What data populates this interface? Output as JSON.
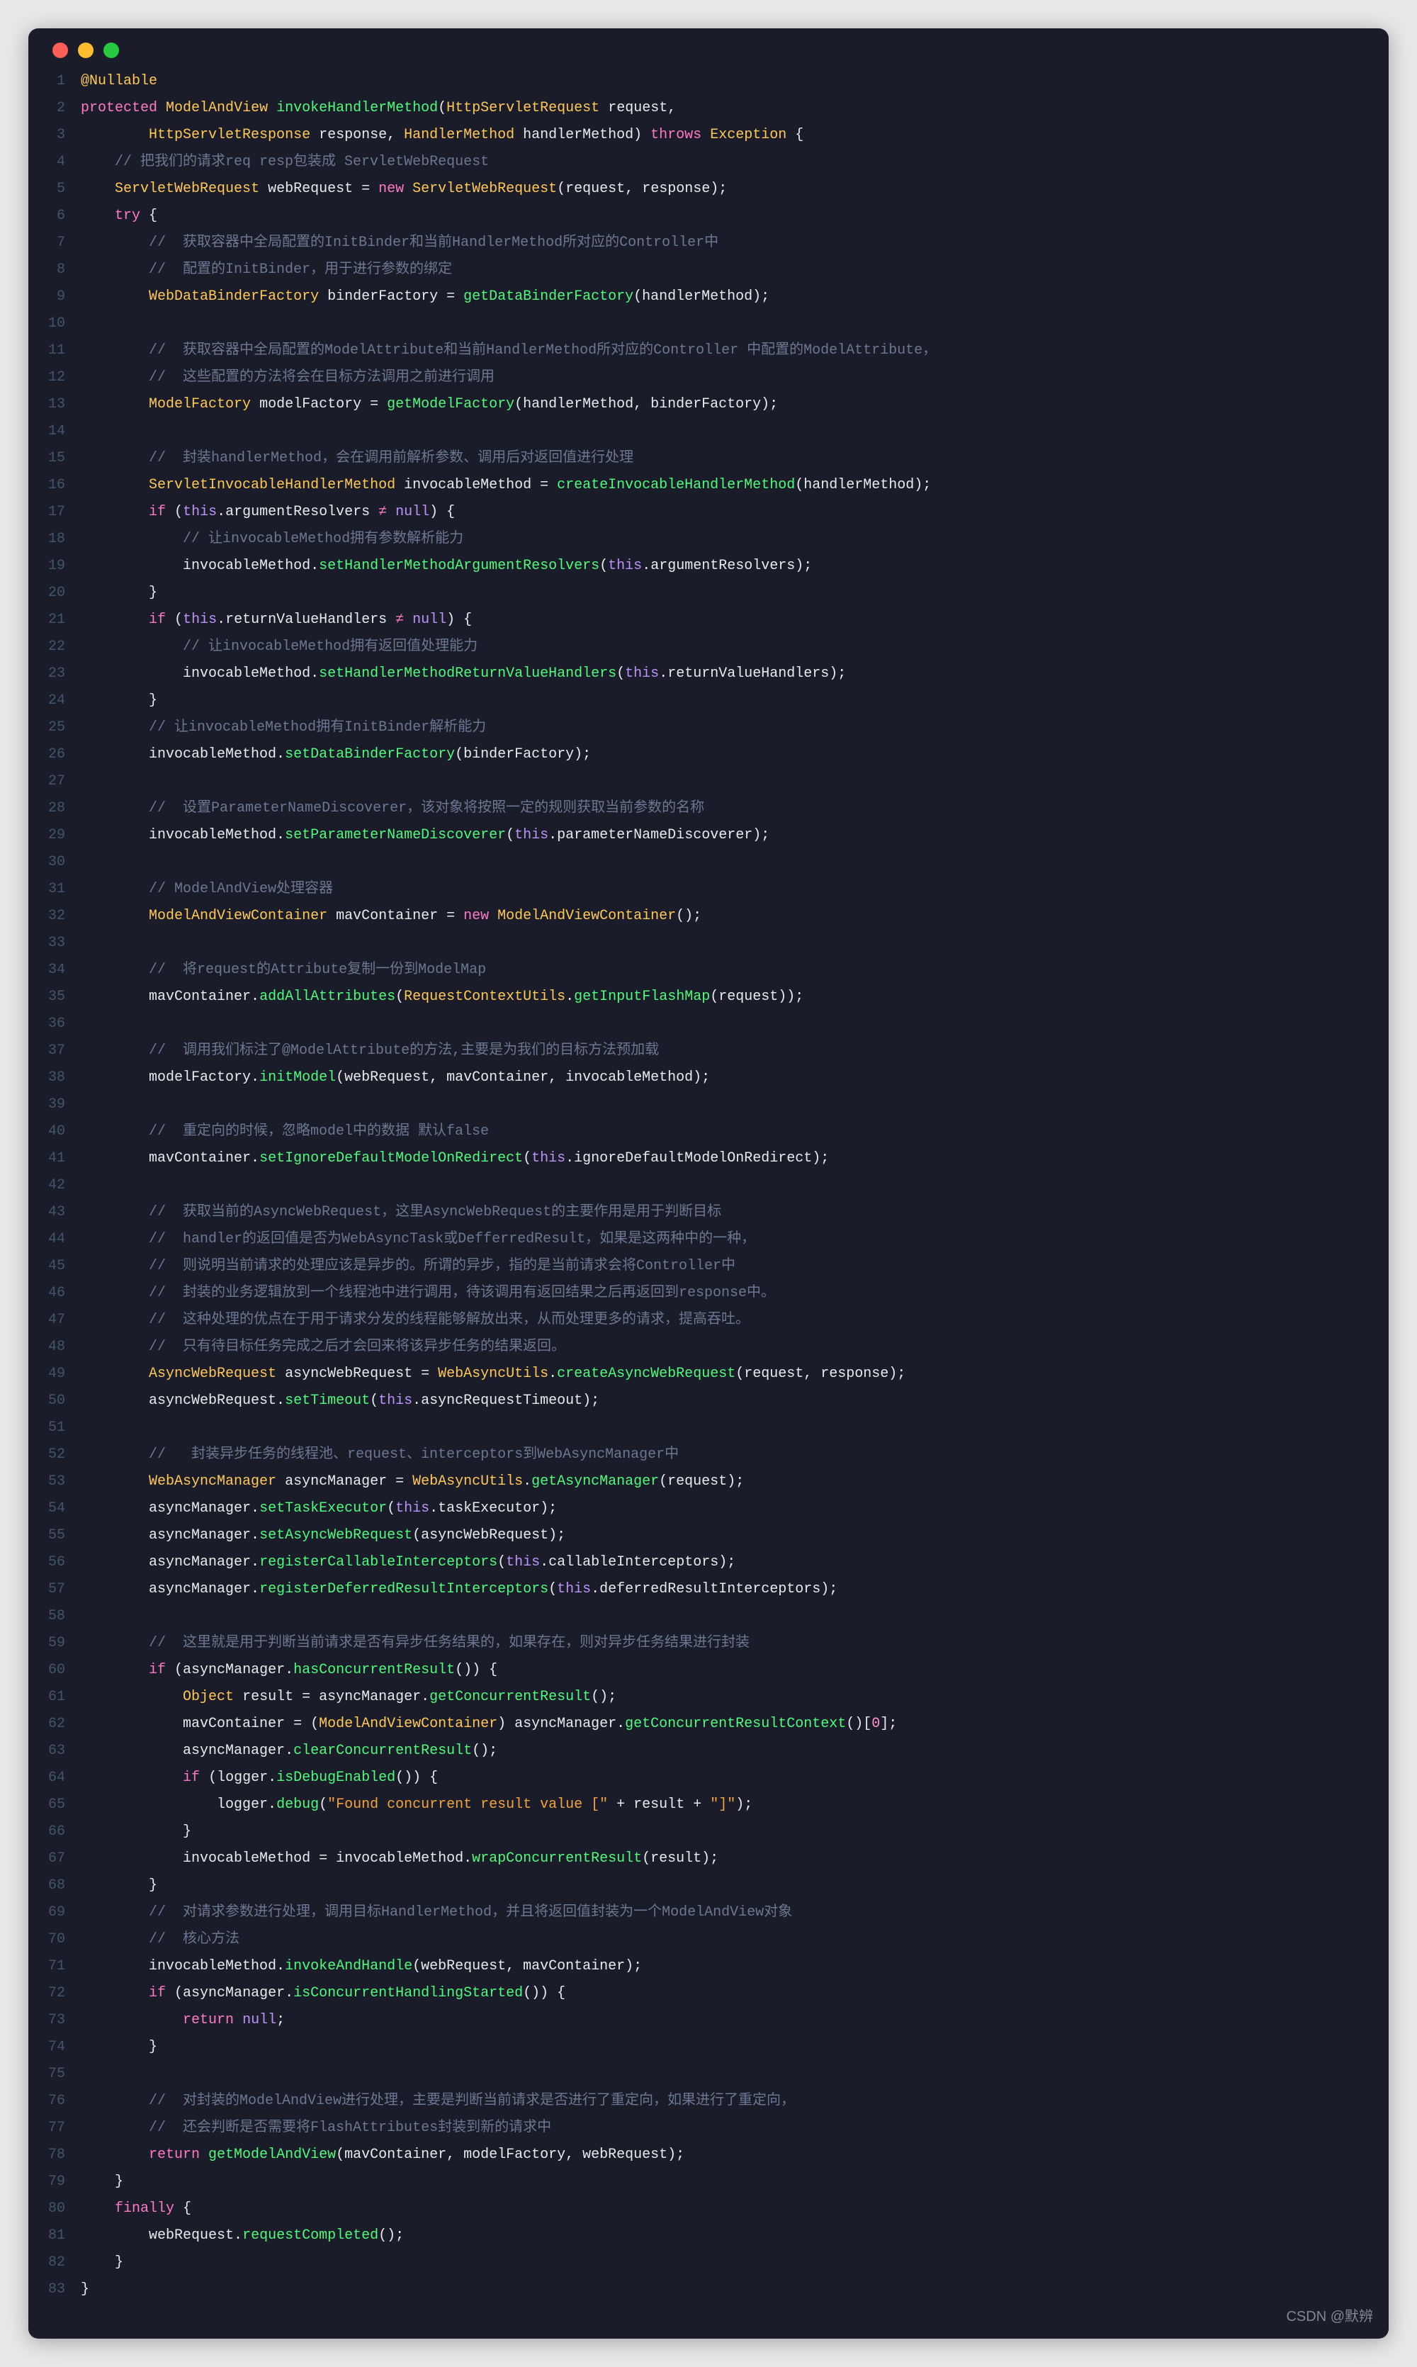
{
  "watermark": "CSDN @默辨",
  "lines": [
    [
      {
        "cls": "ann",
        "txt": "@Nullable"
      }
    ],
    [
      {
        "cls": "key",
        "txt": "protected "
      },
      {
        "cls": "type",
        "txt": "ModelAndView "
      },
      {
        "cls": "fn",
        "txt": "invokeHandlerMethod"
      },
      {
        "cls": "def",
        "txt": "("
      },
      {
        "cls": "type",
        "txt": "HttpServletRequest "
      },
      {
        "cls": "def",
        "txt": "request,"
      }
    ],
    [
      {
        "cls": "def",
        "txt": "        "
      },
      {
        "cls": "type",
        "txt": "HttpServletResponse "
      },
      {
        "cls": "def",
        "txt": "response, "
      },
      {
        "cls": "type",
        "txt": "HandlerMethod "
      },
      {
        "cls": "def",
        "txt": "handlerMethod) "
      },
      {
        "cls": "key",
        "txt": "throws "
      },
      {
        "cls": "type",
        "txt": "Exception "
      },
      {
        "cls": "def",
        "txt": "{"
      }
    ],
    [
      {
        "cls": "def",
        "txt": "    "
      },
      {
        "cls": "comment",
        "txt": "// 把我们的请求req resp包装成 ServletWebRequest"
      }
    ],
    [
      {
        "cls": "def",
        "txt": "    "
      },
      {
        "cls": "type",
        "txt": "ServletWebRequest "
      },
      {
        "cls": "def",
        "txt": "webRequest = "
      },
      {
        "cls": "key",
        "txt": "new "
      },
      {
        "cls": "type",
        "txt": "ServletWebRequest"
      },
      {
        "cls": "def",
        "txt": "(request, response);"
      }
    ],
    [
      {
        "cls": "def",
        "txt": "    "
      },
      {
        "cls": "key",
        "txt": "try "
      },
      {
        "cls": "def",
        "txt": "{"
      }
    ],
    [
      {
        "cls": "def",
        "txt": "        "
      },
      {
        "cls": "comment",
        "txt": "//  获取容器中全局配置的InitBinder和当前HandlerMethod所对应的Controller中"
      }
    ],
    [
      {
        "cls": "def",
        "txt": "        "
      },
      {
        "cls": "comment",
        "txt": "//  配置的InitBinder，用于进行参数的绑定"
      }
    ],
    [
      {
        "cls": "def",
        "txt": "        "
      },
      {
        "cls": "type",
        "txt": "WebDataBinderFactory "
      },
      {
        "cls": "def",
        "txt": "binderFactory = "
      },
      {
        "cls": "fn",
        "txt": "getDataBinderFactory"
      },
      {
        "cls": "def",
        "txt": "(handlerMethod);"
      }
    ],
    [
      {
        "cls": "def",
        "txt": ""
      }
    ],
    [
      {
        "cls": "def",
        "txt": "        "
      },
      {
        "cls": "comment",
        "txt": "//  获取容器中全局配置的ModelAttribute和当前HandlerMethod所对应的Controller 中配置的ModelAttribute，"
      }
    ],
    [
      {
        "cls": "def",
        "txt": "        "
      },
      {
        "cls": "comment",
        "txt": "//  这些配置的方法将会在目标方法调用之前进行调用"
      }
    ],
    [
      {
        "cls": "def",
        "txt": "        "
      },
      {
        "cls": "type",
        "txt": "ModelFactory "
      },
      {
        "cls": "def",
        "txt": "modelFactory = "
      },
      {
        "cls": "fn",
        "txt": "getModelFactory"
      },
      {
        "cls": "def",
        "txt": "(handlerMethod, binderFactory);"
      }
    ],
    [
      {
        "cls": "def",
        "txt": ""
      }
    ],
    [
      {
        "cls": "def",
        "txt": "        "
      },
      {
        "cls": "comment",
        "txt": "//  封装handlerMethod，会在调用前解析参数、调用后对返回值进行处理"
      }
    ],
    [
      {
        "cls": "def",
        "txt": "        "
      },
      {
        "cls": "type",
        "txt": "ServletInvocableHandlerMethod "
      },
      {
        "cls": "def",
        "txt": "invocableMethod = "
      },
      {
        "cls": "fn",
        "txt": "createInvocableHandlerMethod"
      },
      {
        "cls": "def",
        "txt": "(handlerMethod);"
      }
    ],
    [
      {
        "cls": "def",
        "txt": "        "
      },
      {
        "cls": "key",
        "txt": "if "
      },
      {
        "cls": "def",
        "txt": "("
      },
      {
        "cls": "this",
        "txt": "this"
      },
      {
        "cls": "def",
        "txt": ".argumentResolvers "
      },
      {
        "cls": "ne",
        "txt": "≠"
      },
      {
        "cls": "def",
        "txt": " "
      },
      {
        "cls": "null",
        "txt": "null"
      },
      {
        "cls": "def",
        "txt": ") {"
      }
    ],
    [
      {
        "cls": "def",
        "txt": "            "
      },
      {
        "cls": "comment",
        "txt": "// 让invocableMethod拥有参数解析能力"
      }
    ],
    [
      {
        "cls": "def",
        "txt": "            invocableMethod."
      },
      {
        "cls": "fn",
        "txt": "setHandlerMethodArgumentResolvers"
      },
      {
        "cls": "def",
        "txt": "("
      },
      {
        "cls": "this",
        "txt": "this"
      },
      {
        "cls": "def",
        "txt": ".argumentResolvers);"
      }
    ],
    [
      {
        "cls": "def",
        "txt": "        }"
      }
    ],
    [
      {
        "cls": "def",
        "txt": "        "
      },
      {
        "cls": "key",
        "txt": "if "
      },
      {
        "cls": "def",
        "txt": "("
      },
      {
        "cls": "this",
        "txt": "this"
      },
      {
        "cls": "def",
        "txt": ".returnValueHandlers "
      },
      {
        "cls": "ne",
        "txt": "≠"
      },
      {
        "cls": "def",
        "txt": " "
      },
      {
        "cls": "null",
        "txt": "null"
      },
      {
        "cls": "def",
        "txt": ") {"
      }
    ],
    [
      {
        "cls": "def",
        "txt": "            "
      },
      {
        "cls": "comment",
        "txt": "// 让invocableMethod拥有返回值处理能力"
      }
    ],
    [
      {
        "cls": "def",
        "txt": "            invocableMethod."
      },
      {
        "cls": "fn",
        "txt": "setHandlerMethodReturnValueHandlers"
      },
      {
        "cls": "def",
        "txt": "("
      },
      {
        "cls": "this",
        "txt": "this"
      },
      {
        "cls": "def",
        "txt": ".returnValueHandlers);"
      }
    ],
    [
      {
        "cls": "def",
        "txt": "        }"
      }
    ],
    [
      {
        "cls": "def",
        "txt": "        "
      },
      {
        "cls": "comment",
        "txt": "// 让invocableMethod拥有InitBinder解析能力"
      }
    ],
    [
      {
        "cls": "def",
        "txt": "        invocableMethod."
      },
      {
        "cls": "fn",
        "txt": "setDataBinderFactory"
      },
      {
        "cls": "def",
        "txt": "(binderFactory);"
      }
    ],
    [
      {
        "cls": "def",
        "txt": ""
      }
    ],
    [
      {
        "cls": "def",
        "txt": "        "
      },
      {
        "cls": "comment",
        "txt": "//  设置ParameterNameDiscoverer，该对象将按照一定的规则获取当前参数的名称"
      }
    ],
    [
      {
        "cls": "def",
        "txt": "        invocableMethod."
      },
      {
        "cls": "fn",
        "txt": "setParameterNameDiscoverer"
      },
      {
        "cls": "def",
        "txt": "("
      },
      {
        "cls": "this",
        "txt": "this"
      },
      {
        "cls": "def",
        "txt": ".parameterNameDiscoverer);"
      }
    ],
    [
      {
        "cls": "def",
        "txt": ""
      }
    ],
    [
      {
        "cls": "def",
        "txt": "        "
      },
      {
        "cls": "comment",
        "txt": "// ModelAndView处理容器"
      }
    ],
    [
      {
        "cls": "def",
        "txt": "        "
      },
      {
        "cls": "type",
        "txt": "ModelAndViewContainer "
      },
      {
        "cls": "def",
        "txt": "mavContainer = "
      },
      {
        "cls": "key",
        "txt": "new "
      },
      {
        "cls": "type",
        "txt": "ModelAndViewContainer"
      },
      {
        "cls": "def",
        "txt": "();"
      }
    ],
    [
      {
        "cls": "def",
        "txt": ""
      }
    ],
    [
      {
        "cls": "def",
        "txt": "        "
      },
      {
        "cls": "comment",
        "txt": "//  将request的Attribute复制一份到ModelMap"
      }
    ],
    [
      {
        "cls": "def",
        "txt": "        mavContainer."
      },
      {
        "cls": "fn",
        "txt": "addAllAttributes"
      },
      {
        "cls": "def",
        "txt": "("
      },
      {
        "cls": "type",
        "txt": "RequestContextUtils"
      },
      {
        "cls": "def",
        "txt": "."
      },
      {
        "cls": "fn",
        "txt": "getInputFlashMap"
      },
      {
        "cls": "def",
        "txt": "(request));"
      }
    ],
    [
      {
        "cls": "def",
        "txt": ""
      }
    ],
    [
      {
        "cls": "def",
        "txt": "        "
      },
      {
        "cls": "comment",
        "txt": "//  调用我们标注了@ModelAttribute的方法,主要是为我们的目标方法预加载"
      }
    ],
    [
      {
        "cls": "def",
        "txt": "        modelFactory."
      },
      {
        "cls": "fn",
        "txt": "initModel"
      },
      {
        "cls": "def",
        "txt": "(webRequest, mavContainer, invocableMethod);"
      }
    ],
    [
      {
        "cls": "def",
        "txt": ""
      }
    ],
    [
      {
        "cls": "def",
        "txt": "        "
      },
      {
        "cls": "comment",
        "txt": "//  重定向的时候，忽略model中的数据 默认false"
      }
    ],
    [
      {
        "cls": "def",
        "txt": "        mavContainer."
      },
      {
        "cls": "fn",
        "txt": "setIgnoreDefaultModelOnRedirect"
      },
      {
        "cls": "def",
        "txt": "("
      },
      {
        "cls": "this",
        "txt": "this"
      },
      {
        "cls": "def",
        "txt": ".ignoreDefaultModelOnRedirect);"
      }
    ],
    [
      {
        "cls": "def",
        "txt": ""
      }
    ],
    [
      {
        "cls": "def",
        "txt": "        "
      },
      {
        "cls": "comment",
        "txt": "//  获取当前的AsyncWebRequest，这里AsyncWebRequest的主要作用是用于判断目标"
      }
    ],
    [
      {
        "cls": "def",
        "txt": "        "
      },
      {
        "cls": "comment",
        "txt": "//  handler的返回值是否为WebAsyncTask或DefferredResult，如果是这两种中的一种，"
      }
    ],
    [
      {
        "cls": "def",
        "txt": "        "
      },
      {
        "cls": "comment",
        "txt": "//  则说明当前请求的处理应该是异步的。所谓的异步，指的是当前请求会将Controller中"
      }
    ],
    [
      {
        "cls": "def",
        "txt": "        "
      },
      {
        "cls": "comment",
        "txt": "//  封装的业务逻辑放到一个线程池中进行调用，待该调用有返回结果之后再返回到response中。"
      }
    ],
    [
      {
        "cls": "def",
        "txt": "        "
      },
      {
        "cls": "comment",
        "txt": "//  这种处理的优点在于用于请求分发的线程能够解放出来，从而处理更多的请求，提高吞吐。"
      }
    ],
    [
      {
        "cls": "def",
        "txt": "        "
      },
      {
        "cls": "comment",
        "txt": "//  只有待目标任务完成之后才会回来将该异步任务的结果返回。"
      }
    ],
    [
      {
        "cls": "def",
        "txt": "        "
      },
      {
        "cls": "type",
        "txt": "AsyncWebRequest "
      },
      {
        "cls": "def",
        "txt": "asyncWebRequest = "
      },
      {
        "cls": "type",
        "txt": "WebAsyncUtils"
      },
      {
        "cls": "def",
        "txt": "."
      },
      {
        "cls": "fn",
        "txt": "createAsyncWebRequest"
      },
      {
        "cls": "def",
        "txt": "(request, response);"
      }
    ],
    [
      {
        "cls": "def",
        "txt": "        asyncWebRequest."
      },
      {
        "cls": "fn",
        "txt": "setTimeout"
      },
      {
        "cls": "def",
        "txt": "("
      },
      {
        "cls": "this",
        "txt": "this"
      },
      {
        "cls": "def",
        "txt": ".asyncRequestTimeout);"
      }
    ],
    [
      {
        "cls": "def",
        "txt": ""
      }
    ],
    [
      {
        "cls": "def",
        "txt": "        "
      },
      {
        "cls": "comment",
        "txt": "//   封装异步任务的线程池、request、interceptors到WebAsyncManager中"
      }
    ],
    [
      {
        "cls": "def",
        "txt": "        "
      },
      {
        "cls": "type",
        "txt": "WebAsyncManager "
      },
      {
        "cls": "def",
        "txt": "asyncManager = "
      },
      {
        "cls": "type",
        "txt": "WebAsyncUtils"
      },
      {
        "cls": "def",
        "txt": "."
      },
      {
        "cls": "fn",
        "txt": "getAsyncManager"
      },
      {
        "cls": "def",
        "txt": "(request);"
      }
    ],
    [
      {
        "cls": "def",
        "txt": "        asyncManager."
      },
      {
        "cls": "fn",
        "txt": "setTaskExecutor"
      },
      {
        "cls": "def",
        "txt": "("
      },
      {
        "cls": "this",
        "txt": "this"
      },
      {
        "cls": "def",
        "txt": ".taskExecutor);"
      }
    ],
    [
      {
        "cls": "def",
        "txt": "        asyncManager."
      },
      {
        "cls": "fn",
        "txt": "setAsyncWebRequest"
      },
      {
        "cls": "def",
        "txt": "(asyncWebRequest);"
      }
    ],
    [
      {
        "cls": "def",
        "txt": "        asyncManager."
      },
      {
        "cls": "fn",
        "txt": "registerCallableInterceptors"
      },
      {
        "cls": "def",
        "txt": "("
      },
      {
        "cls": "this",
        "txt": "this"
      },
      {
        "cls": "def",
        "txt": ".callableInterceptors);"
      }
    ],
    [
      {
        "cls": "def",
        "txt": "        asyncManager."
      },
      {
        "cls": "fn",
        "txt": "registerDeferredResultInterceptors"
      },
      {
        "cls": "def",
        "txt": "("
      },
      {
        "cls": "this",
        "txt": "this"
      },
      {
        "cls": "def",
        "txt": ".deferredResultInterceptors);"
      }
    ],
    [
      {
        "cls": "def",
        "txt": ""
      }
    ],
    [
      {
        "cls": "def",
        "txt": "        "
      },
      {
        "cls": "comment",
        "txt": "//  这里就是用于判断当前请求是否有异步任务结果的，如果存在，则对异步任务结果进行封装"
      }
    ],
    [
      {
        "cls": "def",
        "txt": "        "
      },
      {
        "cls": "key",
        "txt": "if "
      },
      {
        "cls": "def",
        "txt": "(asyncManager."
      },
      {
        "cls": "fn",
        "txt": "hasConcurrentResult"
      },
      {
        "cls": "def",
        "txt": "()) {"
      }
    ],
    [
      {
        "cls": "def",
        "txt": "            "
      },
      {
        "cls": "type",
        "txt": "Object "
      },
      {
        "cls": "def",
        "txt": "result = asyncManager."
      },
      {
        "cls": "fn",
        "txt": "getConcurrentResult"
      },
      {
        "cls": "def",
        "txt": "();"
      }
    ],
    [
      {
        "cls": "def",
        "txt": "            mavContainer = ("
      },
      {
        "cls": "type",
        "txt": "ModelAndViewContainer"
      },
      {
        "cls": "def",
        "txt": ") asyncManager."
      },
      {
        "cls": "fn",
        "txt": "getConcurrentResultContext"
      },
      {
        "cls": "def",
        "txt": "()["
      },
      {
        "cls": "num",
        "txt": "0"
      },
      {
        "cls": "def",
        "txt": "];"
      }
    ],
    [
      {
        "cls": "def",
        "txt": "            asyncManager."
      },
      {
        "cls": "fn",
        "txt": "clearConcurrentResult"
      },
      {
        "cls": "def",
        "txt": "();"
      }
    ],
    [
      {
        "cls": "def",
        "txt": "            "
      },
      {
        "cls": "key",
        "txt": "if "
      },
      {
        "cls": "def",
        "txt": "(logger."
      },
      {
        "cls": "fn",
        "txt": "isDebugEnabled"
      },
      {
        "cls": "def",
        "txt": "()) {"
      }
    ],
    [
      {
        "cls": "def",
        "txt": "                logger."
      },
      {
        "cls": "fn",
        "txt": "debug"
      },
      {
        "cls": "def",
        "txt": "("
      },
      {
        "cls": "str",
        "txt": "\"Found concurrent result value [\""
      },
      {
        "cls": "def",
        "txt": " + result + "
      },
      {
        "cls": "str",
        "txt": "\"]\""
      },
      {
        "cls": "def",
        "txt": ");"
      }
    ],
    [
      {
        "cls": "def",
        "txt": "            }"
      }
    ],
    [
      {
        "cls": "def",
        "txt": "            invocableMethod = invocableMethod."
      },
      {
        "cls": "fn",
        "txt": "wrapConcurrentResult"
      },
      {
        "cls": "def",
        "txt": "(result);"
      }
    ],
    [
      {
        "cls": "def",
        "txt": "        }"
      }
    ],
    [
      {
        "cls": "def",
        "txt": "        "
      },
      {
        "cls": "comment",
        "txt": "//  对请求参数进行处理，调用目标HandlerMethod，并且将返回值封装为一个ModelAndView对象"
      }
    ],
    [
      {
        "cls": "def",
        "txt": "        "
      },
      {
        "cls": "comment",
        "txt": "//  核心方法"
      }
    ],
    [
      {
        "cls": "def",
        "txt": "        invocableMethod."
      },
      {
        "cls": "fn",
        "txt": "invokeAndHandle"
      },
      {
        "cls": "def",
        "txt": "(webRequest, mavContainer);"
      }
    ],
    [
      {
        "cls": "def",
        "txt": "        "
      },
      {
        "cls": "key",
        "txt": "if "
      },
      {
        "cls": "def",
        "txt": "(asyncManager."
      },
      {
        "cls": "fn",
        "txt": "isConcurrentHandlingStarted"
      },
      {
        "cls": "def",
        "txt": "()) {"
      }
    ],
    [
      {
        "cls": "def",
        "txt": "            "
      },
      {
        "cls": "key",
        "txt": "return "
      },
      {
        "cls": "null",
        "txt": "null"
      },
      {
        "cls": "def",
        "txt": ";"
      }
    ],
    [
      {
        "cls": "def",
        "txt": "        }"
      }
    ],
    [
      {
        "cls": "def",
        "txt": ""
      }
    ],
    [
      {
        "cls": "def",
        "txt": "        "
      },
      {
        "cls": "comment",
        "txt": "//  对封装的ModelAndView进行处理，主要是判断当前请求是否进行了重定向，如果进行了重定向，"
      }
    ],
    [
      {
        "cls": "def",
        "txt": "        "
      },
      {
        "cls": "comment",
        "txt": "//  还会判断是否需要将FlashAttributes封装到新的请求中"
      }
    ],
    [
      {
        "cls": "def",
        "txt": "        "
      },
      {
        "cls": "key",
        "txt": "return "
      },
      {
        "cls": "fn",
        "txt": "getModelAndView"
      },
      {
        "cls": "def",
        "txt": "(mavContainer, modelFactory, webRequest);"
      }
    ],
    [
      {
        "cls": "def",
        "txt": "    }"
      }
    ],
    [
      {
        "cls": "def",
        "txt": "    "
      },
      {
        "cls": "key",
        "txt": "finally "
      },
      {
        "cls": "def",
        "txt": "{"
      }
    ],
    [
      {
        "cls": "def",
        "txt": "        webRequest."
      },
      {
        "cls": "fn",
        "txt": "requestCompleted"
      },
      {
        "cls": "def",
        "txt": "();"
      }
    ],
    [
      {
        "cls": "def",
        "txt": "    }"
      }
    ],
    [
      {
        "cls": "def",
        "txt": "}"
      }
    ]
  ]
}
